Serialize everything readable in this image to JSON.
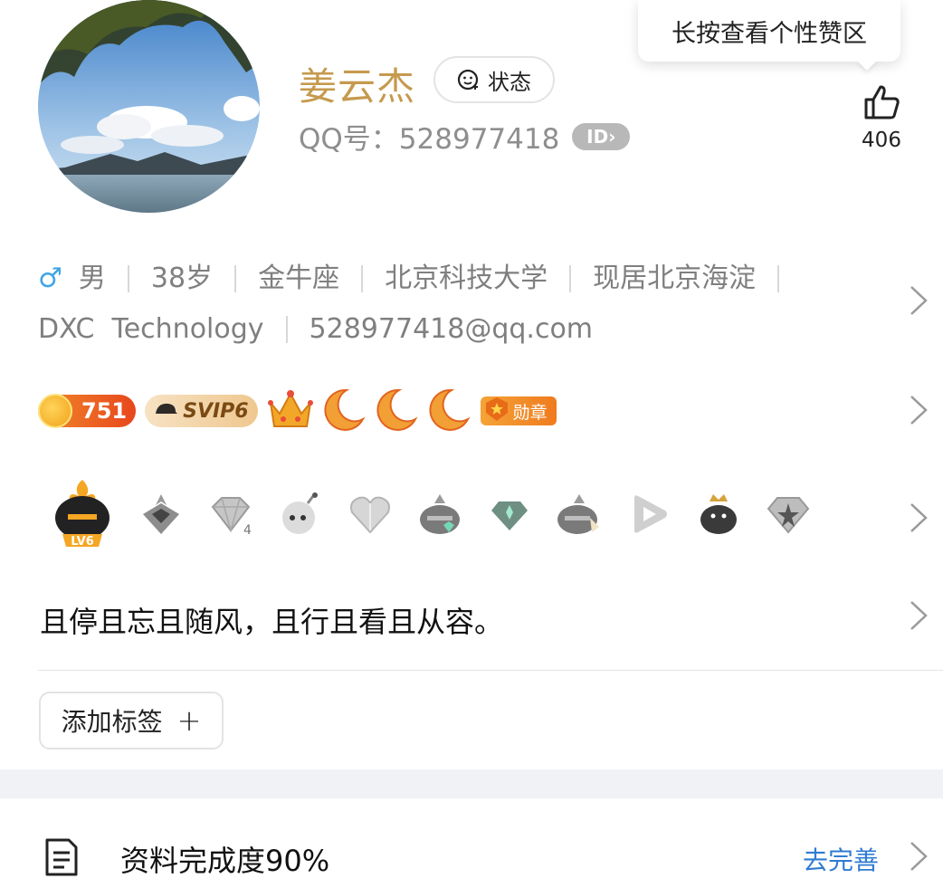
{
  "profile": {
    "name": "姜云杰",
    "status_label": "状态",
    "qq_line": "QQ号：528977418",
    "id_badge": "ID"
  },
  "tooltip": {
    "text": "长按查看个性赞区"
  },
  "likes": {
    "count": "406"
  },
  "info": {
    "gender_icon": "♂",
    "row1": [
      "男",
      "38岁",
      "金牛座",
      "北京科技大学",
      "现居北京海淀"
    ],
    "row2": [
      "DXC  Technology",
      "528977418@qq.com"
    ]
  },
  "badges": {
    "level": "751",
    "svip": "SVIP6",
    "medal": "勋章"
  },
  "icons": {
    "lv_label": "LV6",
    "items": [
      "lv6-penguin-icon",
      "penguin-gem-icon",
      "diamond-4-icon",
      "bomb-face-icon",
      "heart-gem-icon",
      "penguin-green-gem-icon",
      "green-diamond-icon",
      "penguin-feather-icon",
      "play-icon",
      "penguin-crown-icon",
      "silver-star-gem-icon"
    ]
  },
  "signature": {
    "text": "且停且忘且随风，且行且看且从容。"
  },
  "tag": {
    "label": "添加标签",
    "plus": "+"
  },
  "completion": {
    "text": "资料完成度90%",
    "percent": 90,
    "link": "去完善"
  },
  "colors": {
    "name": "#c59a4e",
    "link": "#2f7bd3",
    "gender": "#3fa5e6",
    "band": "#f1f2f6"
  }
}
